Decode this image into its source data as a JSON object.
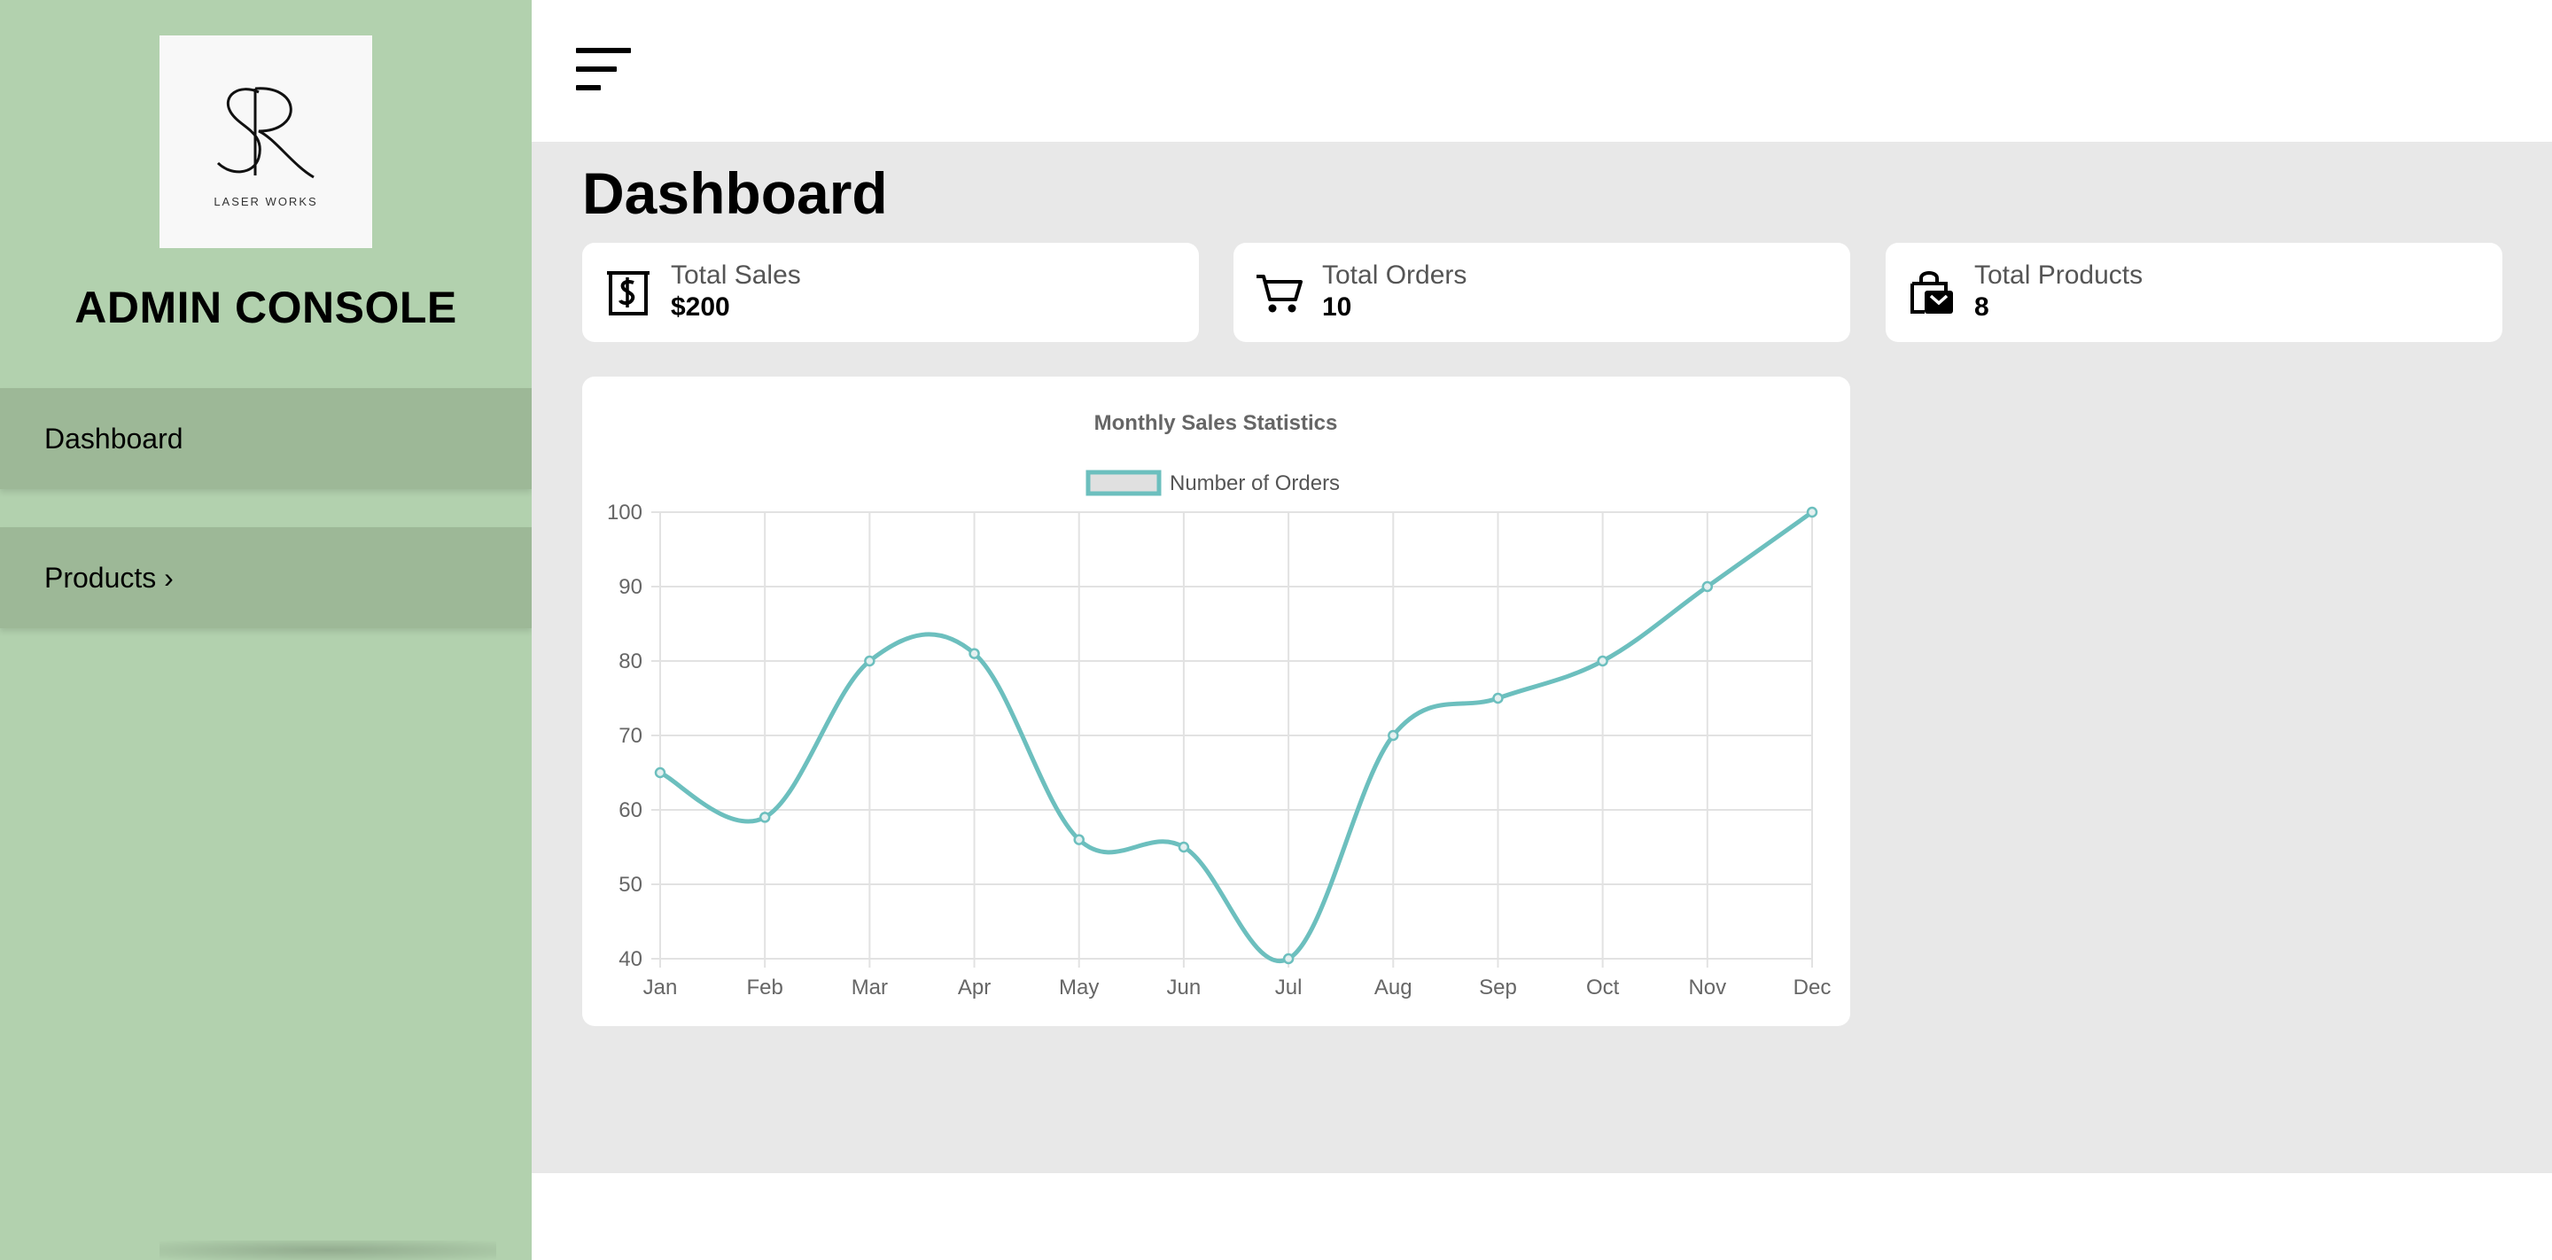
{
  "sidebar": {
    "logo": {
      "main": "SR",
      "sub": "LASER WORKS"
    },
    "title": "ADMIN CONSOLE",
    "items": [
      {
        "label": "Dashboard"
      },
      {
        "label": "Products ›"
      }
    ]
  },
  "header": {
    "menu_icon": "hamburger-menu-icon"
  },
  "main": {
    "title": "Dashboard",
    "cards": [
      {
        "label": "Total Sales",
        "value": "$200",
        "icon": "receipt-dollar-icon"
      },
      {
        "label": "Total Orders",
        "value": "10",
        "icon": "shopping-cart-icon"
      },
      {
        "label": "Total Products",
        "value": "8",
        "icon": "shopping-bag-icon"
      }
    ]
  },
  "colors": {
    "sidebar_bg": "#b2d1ae",
    "nav_item_bg": "#9db897",
    "content_bg": "#e8e8e8",
    "line": "#6cbfbe",
    "legend_fill": "#e0e0e0"
  },
  "chart_data": {
    "type": "line",
    "title": "Monthly Sales Statistics",
    "legend_position": "top",
    "grid": true,
    "categories": [
      "Jan",
      "Feb",
      "Mar",
      "Apr",
      "May",
      "Jun",
      "Jul",
      "Aug",
      "Sep",
      "Oct",
      "Nov",
      "Dec"
    ],
    "series": [
      {
        "name": "Number of Orders",
        "values": [
          65,
          59,
          80,
          81,
          56,
          55,
          40,
          70,
          75,
          80,
          90,
          100
        ]
      }
    ],
    "ylim": [
      40,
      100
    ],
    "yticks": [
      40,
      50,
      60,
      70,
      80,
      90,
      100
    ]
  }
}
